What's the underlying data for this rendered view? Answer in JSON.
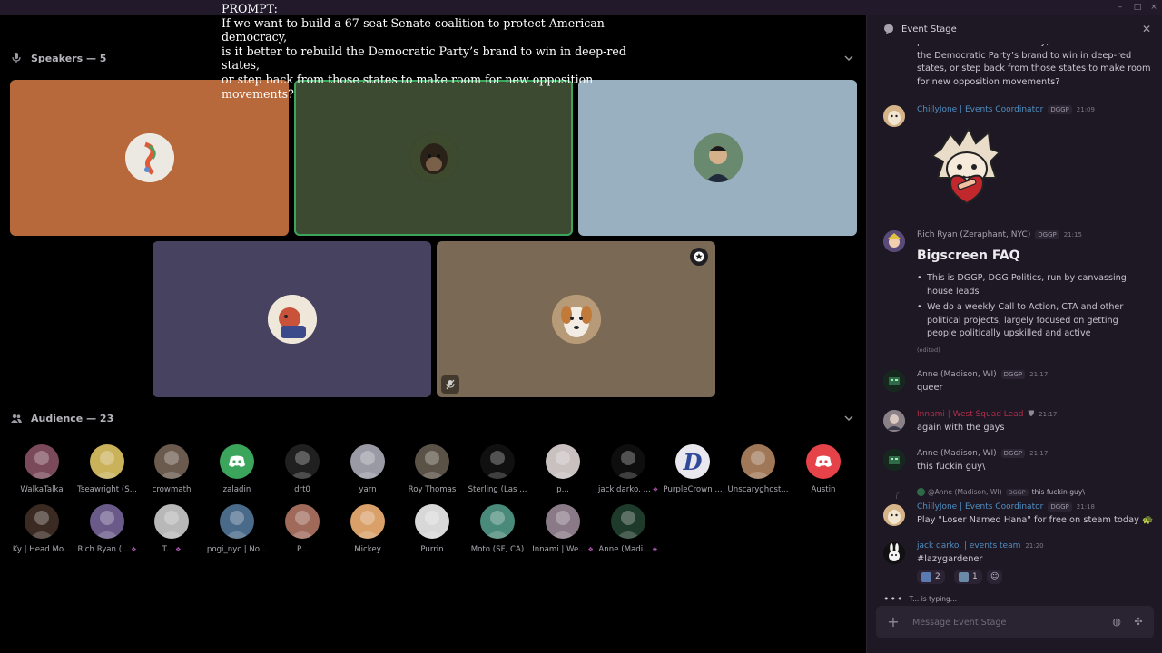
{
  "window": {
    "minimize": "–",
    "maximize": "□",
    "close": "×"
  },
  "prompt": {
    "text": "PROMPT:\nIf we want to build a 67-seat Senate coalition to protect American democracy,\nis it better to rebuild the Democratic Party’s brand to win in deep-red states,\nor step back from those states to make room for new opposition movements?"
  },
  "speakers": {
    "header": "Speakers — 5",
    "tiles": [
      {
        "bg": "#b8693b"
      },
      {
        "bg": "#3c4a32",
        "active": true
      },
      {
        "bg": "#98b0c0"
      },
      {
        "bg": "#46425f"
      },
      {
        "bg": "#7a6a55"
      }
    ]
  },
  "audience": {
    "header": "Audience — 23",
    "members": [
      {
        "name": "WalkaTalka",
        "color": "#7a4a5a"
      },
      {
        "name": "Tseawright (S...",
        "color": "#c9b25a"
      },
      {
        "name": "crowmath",
        "color": "#6b5a4e"
      },
      {
        "name": "zaladin",
        "color": "#3ba55c"
      },
      {
        "name": "drt0",
        "color": "#202020"
      },
      {
        "name": "yarn",
        "color": "#9a9aa5"
      },
      {
        "name": "Roy Thomas",
        "color": "#5a5246"
      },
      {
        "name": "Sterling (Las ...",
        "color": "#101010"
      },
      {
        "name": "p...",
        "color": "#c9c0c0"
      },
      {
        "name": "jack darko. ...",
        "color": "#0e0e0e",
        "boost": "❖"
      },
      {
        "name": "PurpleCrown ...",
        "color": "#e8e8ee"
      },
      {
        "name": "Unscaryghost...",
        "color": "#a07858"
      },
      {
        "name": "Austin",
        "color": "#e64249"
      },
      {
        "name": "Ky | Head Mo...",
        "color": "#3a2a22"
      },
      {
        "name": "Rich Ryan (...",
        "color": "#6a5a8a",
        "boost": "❖"
      },
      {
        "name": "T...",
        "color": "#b8b8b8",
        "boost": "❖"
      },
      {
        "name": "pogi_nyc | No...",
        "color": "#4a6a8a"
      },
      {
        "name": "P...",
        "color": "#a06a5a"
      },
      {
        "name": "Mickey",
        "color": "#d9a06a"
      },
      {
        "name": "Purrin",
        "color": "#d8d8d8"
      },
      {
        "name": "Moto (SF, CA)",
        "color": "#4a8a7a"
      },
      {
        "name": "Innami | We...",
        "color": "#8a7a88",
        "boost": "❖"
      },
      {
        "name": "Anne (Madi...",
        "color": "#1e3a2a",
        "boost": "❖"
      }
    ]
  },
  "chat": {
    "title": "Event Stage",
    "partial_top": "protect American democracy, is it better to rebuild\nthe Democratic Party’s brand to win in deep-red\nstates, or step back from those states to make room\nfor new opposition movements?",
    "messages": [
      {
        "author": "ChillyJone | Events Coordinator",
        "author_color": "#4f8fc0",
        "tag": "DGGP",
        "time": "21:09",
        "avatar_color": "#c9a26a"
      },
      {
        "author": "Rich Ryan (Zeraphant, NYC)",
        "author_color": "#a8a4ae",
        "tag": "DGGP",
        "time": "21:15",
        "avatar_color": "#6a5a8a"
      },
      {
        "author": "Anne (Madison, WI)",
        "author_color": "#a8a4ae",
        "tag": "DGGP",
        "time": "21:17",
        "text": "queer",
        "avatar_color": "#1e3a2a"
      },
      {
        "author": "Innami | West Squad Lead",
        "author_color": "#b0304a",
        "tag": "",
        "time": "21:17",
        "text": "again with the gays",
        "avatar_color": "#8a7a88"
      },
      {
        "author": "Anne (Madison, WI)",
        "author_color": "#a8a4ae",
        "tag": "DGGP",
        "time": "21:17",
        "text": "this fuckin guy\\",
        "avatar_color": "#1e3a2a"
      },
      {
        "author": "ChillyJone | Events Coordinator",
        "author_color": "#4f8fc0",
        "tag": "DGGP",
        "time": "21:18",
        "text": "Play \"Loser Named Hana\" for free on steam today 🐢",
        "avatar_color": "#c9a26a"
      },
      {
        "author": "jack darko. | events team",
        "author_color": "#4f8fc0",
        "tag": "",
        "time": "21:20",
        "text": "#lazygardener",
        "avatar_color": "#0e0e0e"
      }
    ],
    "faq": {
      "title": "Bigscreen FAQ",
      "items": [
        "This is DGGP, DGG Politics, run by canvassing house leads",
        "We do a weekly Call to Action, CTA and other political projects, largely focused on getting people politically upskilled and active"
      ],
      "edited": "(edited)"
    },
    "reply": {
      "author": "@Anne (Madison, WI)",
      "tag": "DGGP",
      "text": "this fuckin guy\\"
    },
    "reactions": [
      {
        "count": "2"
      },
      {
        "count": "1"
      }
    ],
    "typing": "T... is typing...",
    "composer": {
      "placeholder": "Message Event Stage"
    }
  }
}
